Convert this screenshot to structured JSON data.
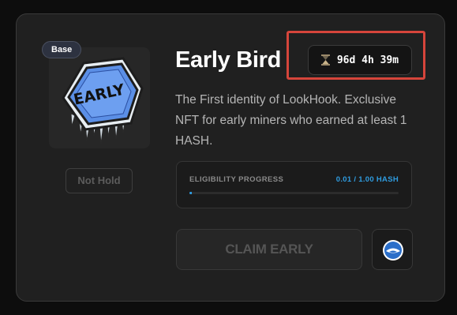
{
  "card": {
    "chain_badge": "Base",
    "hold_status": "Not Hold",
    "title": "Early Bird",
    "timer": "96d 4h 39m",
    "timer_icon": "hourglass-icon",
    "description": "The First identity of LookHook. Exclusive NFT for early miners who earned at least 1 HASH.",
    "nft_image_text": "EARLY",
    "progress": {
      "label": "ELIGIBILITY PROGRESS",
      "value_text": "0.01 / 1.00 HASH",
      "current": 0.01,
      "target": 1.0
    },
    "claim_button": "CLAIM EARLY",
    "chain_icon": "base-logo-icon"
  },
  "colors": {
    "accent": "#2f9ce0",
    "highlight": "#d6453b",
    "card_bg": "#202020",
    "badge_blue": "#5b8fe6"
  }
}
